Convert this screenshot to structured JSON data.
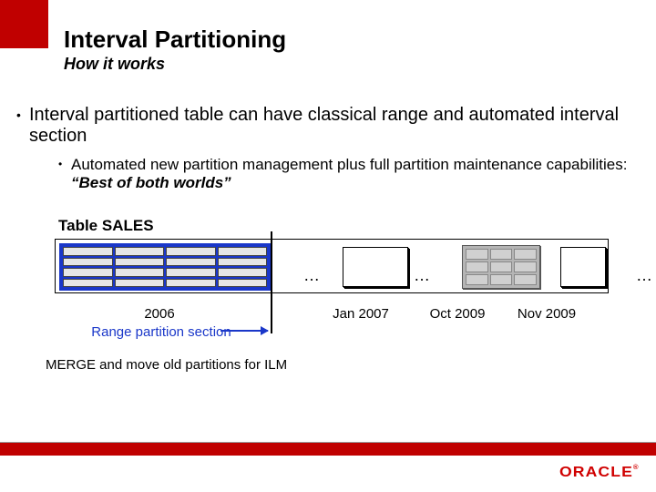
{
  "title": "Interval Partitioning",
  "subtitle": "How it works",
  "bullets": {
    "l1": "Interval partitioned table can have classical range and automated interval section",
    "l2_a": "Automated new partition management plus full partition maintenance capabilities: ",
    "l2_b": "“Best of both worlds”"
  },
  "table_label": "Table SALES",
  "ellipsis": "…",
  "labels": {
    "y2006": "2006",
    "range_section": "Range partition section",
    "jan2007": "Jan 2007",
    "oct2009": "Oct 2009",
    "nov2009": "Nov 2009"
  },
  "merge_note": "MERGE and move old partitions for ILM",
  "brand": "ORACLE",
  "brand_tm": "®"
}
